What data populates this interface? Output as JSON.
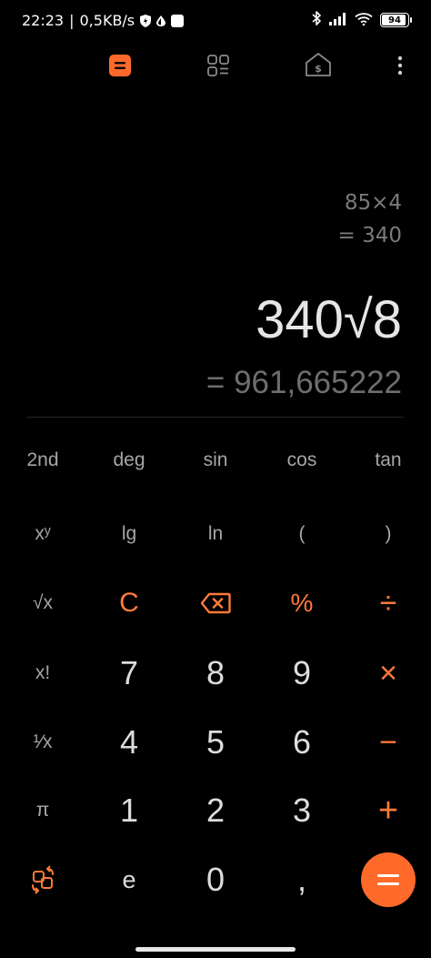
{
  "status_bar": {
    "time": "22:23",
    "separator": "|",
    "net_speed": "0,5KB/s",
    "battery": "94",
    "battery_level": 0.94
  },
  "history": {
    "expression": "85×4",
    "result": "= 340"
  },
  "display": {
    "expression": "340√8",
    "result": "= 961,665222"
  },
  "keys": {
    "row1": [
      "2nd",
      "deg",
      "sin",
      "cos",
      "tan"
    ],
    "row2": [
      "xʸ",
      "lg",
      "ln",
      "(",
      ")"
    ],
    "row3": [
      "√x",
      "C",
      "⌫",
      "%",
      "÷"
    ],
    "row4": [
      "x!",
      "7",
      "8",
      "9",
      "×"
    ],
    "row5": [
      "¹⁄x",
      "4",
      "5",
      "6",
      "−"
    ],
    "row6": [
      "π",
      "1",
      "2",
      "3",
      "+"
    ],
    "row7": [
      "⟲",
      "e",
      "0",
      ",",
      "="
    ]
  },
  "colors": {
    "accent": "#ff6a2b",
    "background": "#000000",
    "text_primary": "#e6e6e6",
    "text_secondary": "#6e6e6e"
  },
  "icons": {
    "calc_mode": "calculator-icon",
    "converter": "grid-icon",
    "currency": "currency-house-icon",
    "more": "more-vertical-icon",
    "swap": "swap-icon",
    "backspace": "backspace-icon"
  }
}
